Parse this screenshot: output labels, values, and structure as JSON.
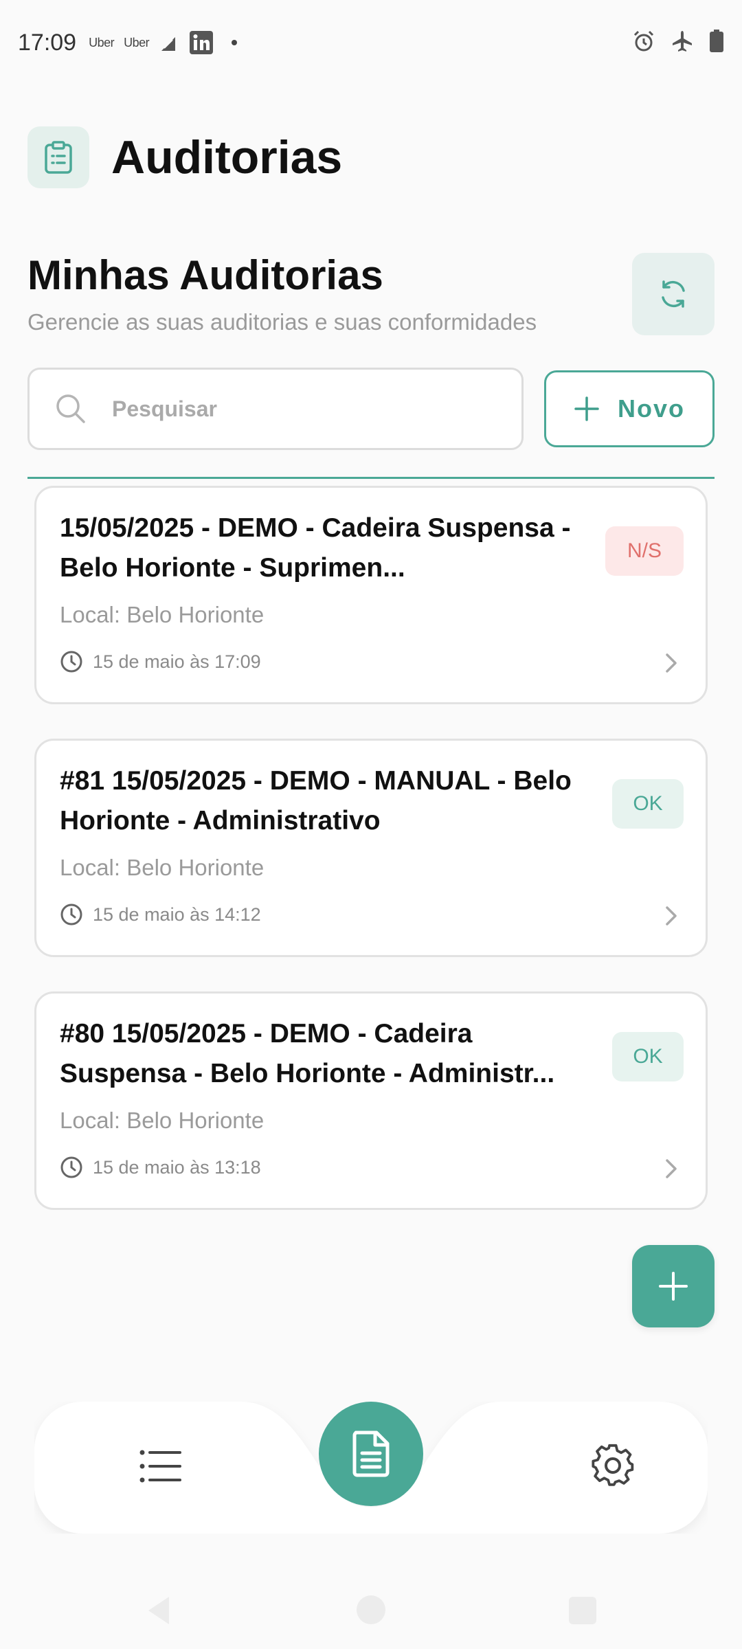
{
  "status_bar": {
    "time": "17:09",
    "apps": [
      "Uber",
      "Uber"
    ],
    "icons": [
      "signal-stack-icon",
      "linkedin-icon",
      "notification-dot",
      "alarm-icon",
      "airplane-icon",
      "battery-icon"
    ]
  },
  "header": {
    "logo_icon": "clipboard-icon",
    "title": "Auditorias"
  },
  "section": {
    "title": "Minhas Auditorias",
    "subtitle": "Gerencie as suas auditorias e suas conformidades",
    "refresh_icon": "refresh-icon"
  },
  "search": {
    "placeholder": "Pesquisar",
    "value": ""
  },
  "new_button": {
    "label": "Novo"
  },
  "audits": [
    {
      "title": "15/05/2025 - DEMO - Cadeira Suspensa - Belo Horionte - Suprimen...",
      "status": "N/S",
      "local": "Local: Belo Horionte",
      "time": "15 de maio às 17:09"
    },
    {
      "title": "#81 15/05/2025 - DEMO - MANUAL - Belo Horionte - Administrativo",
      "status": "OK",
      "local": "Local: Belo Horionte",
      "time": "15 de maio às 14:12"
    },
    {
      "title": "#80 15/05/2025 - DEMO - Cadeira Suspensa - Belo Horionte - Administr...",
      "status": "OK",
      "local": "Local: Belo Horionte",
      "time": "15 de maio às 13:18"
    }
  ],
  "colors": {
    "accent": "#4aa896",
    "accent_light": "#e6f0ee",
    "danger_bg": "#fde8e8",
    "danger_text": "#e0706c"
  },
  "bottom_nav": {
    "items": [
      "list-icon",
      "document-icon",
      "gear-icon"
    ],
    "active": "document-icon"
  }
}
